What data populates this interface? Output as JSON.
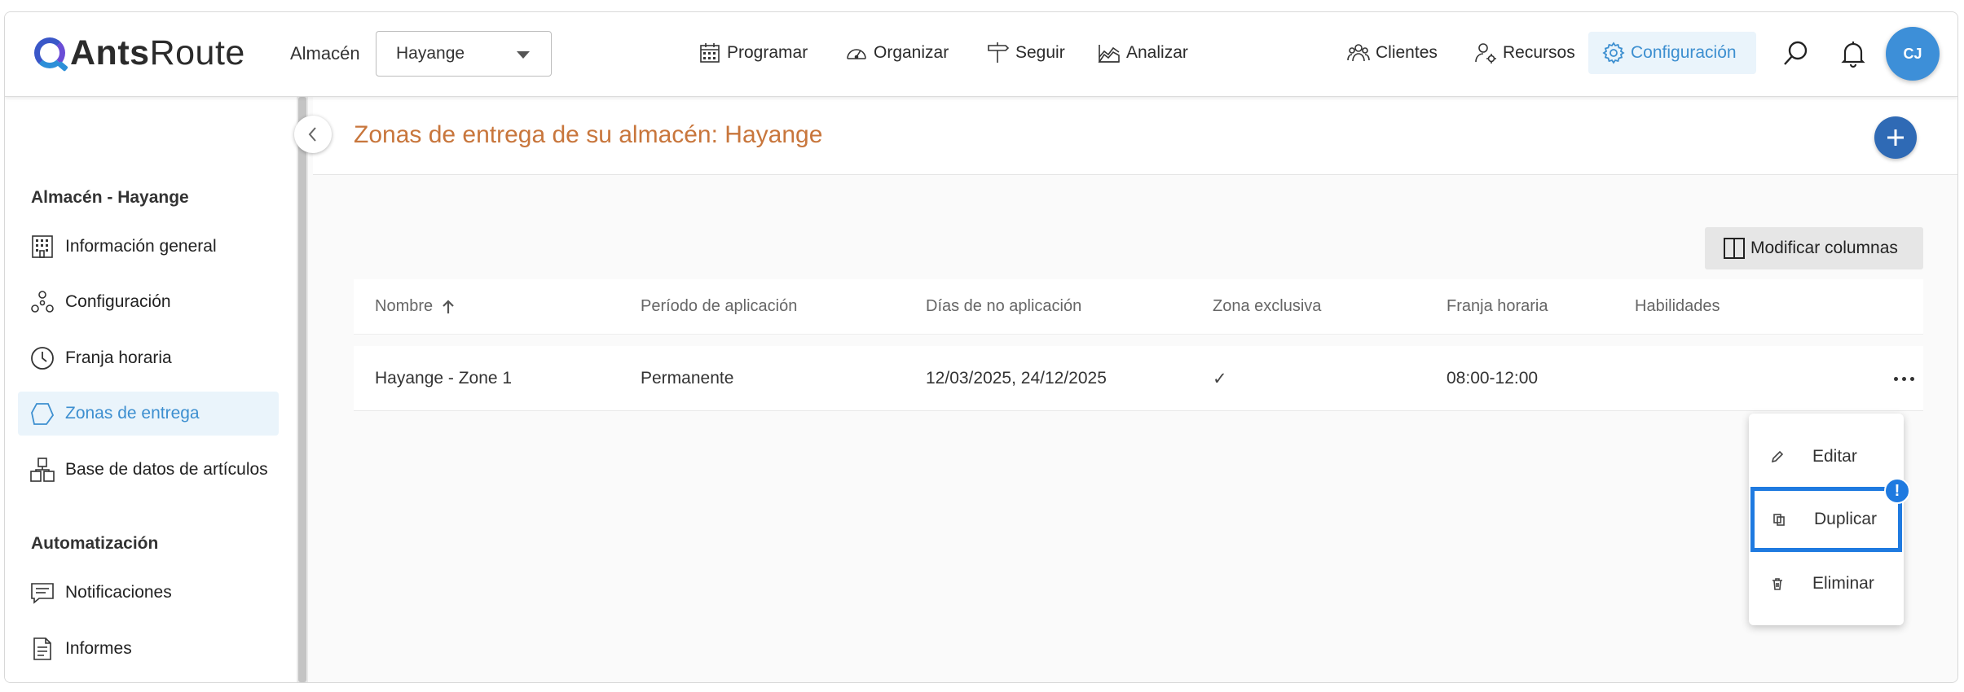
{
  "app": {
    "logo_bold": "Ants",
    "logo_light": "Route"
  },
  "header": {
    "warehouse_label": "Almacén",
    "warehouse_value": "Hayange",
    "nav": [
      {
        "label": "Programar",
        "icon": "calendar-icon"
      },
      {
        "label": "Organizar",
        "icon": "gauge-icon"
      },
      {
        "label": "Seguir",
        "icon": "signpost-icon"
      },
      {
        "label": "Analizar",
        "icon": "chart-icon"
      }
    ],
    "right_nav": [
      {
        "label": "Clientes",
        "icon": "users-icon"
      },
      {
        "label": "Recursos",
        "icon": "user-gear-icon"
      },
      {
        "label": "Configuración",
        "icon": "gear-icon"
      }
    ],
    "avatar": "CJ",
    "accent": "#3d8fd0"
  },
  "sidebar": {
    "section1": "Almacén - Hayange",
    "items1": [
      {
        "label": "Información general",
        "icon": "building-icon"
      },
      {
        "label": "Configuración",
        "icon": "nodes-icon"
      },
      {
        "label": "Franja horaria",
        "icon": "clock-icon"
      },
      {
        "label": "Zonas de entrega",
        "icon": "polygon-icon",
        "active": true
      },
      {
        "label": "Base de datos de artículos",
        "icon": "boxes-icon"
      }
    ],
    "section2": "Automatización",
    "items2": [
      {
        "label": "Notificaciones",
        "icon": "message-icon"
      },
      {
        "label": "Informes",
        "icon": "document-icon"
      }
    ]
  },
  "main": {
    "title": "Zonas de entrega de su almacén: Hayange",
    "modify_columns": "Modificar columnas",
    "columns": [
      "Nombre",
      "Período de aplicación",
      "Días de no aplicación",
      "Zona exclusiva",
      "Franja horaria",
      "Habilidades"
    ],
    "rows": [
      {
        "name": "Hayange - Zone 1",
        "period": "Permanente",
        "days": "12/03/2025, 24/12/2025",
        "exclusive": "✓",
        "slot": "08:00-12:00",
        "skills": ""
      }
    ]
  },
  "row_menu": {
    "items": [
      "Editar",
      "Duplicar",
      "Eliminar"
    ],
    "highlighted": "Duplicar",
    "badge": "!"
  },
  "title_color": "#c8763c"
}
